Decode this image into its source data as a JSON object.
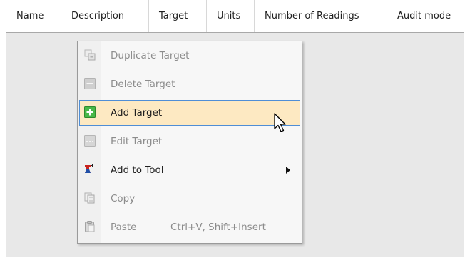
{
  "columns": [
    "Name",
    "Description",
    "Target",
    "Units",
    "Number of Readings",
    "Audit mode"
  ],
  "menu": {
    "items": [
      {
        "label": "Duplicate Target",
        "icon": "duplicate-icon",
        "enabled": false
      },
      {
        "label": "Delete Target",
        "icon": "minus-icon",
        "enabled": false
      },
      {
        "label": "Add Target",
        "icon": "plus-icon",
        "enabled": true,
        "highlighted": true
      },
      {
        "label": "Edit Target",
        "icon": "ellipsis-icon",
        "enabled": false
      },
      {
        "label": "Add to Tool",
        "icon": "tool-icon",
        "enabled": true,
        "submenu": true
      },
      {
        "label": "Copy",
        "icon": "copy-icon",
        "enabled": false
      },
      {
        "label": "Paste",
        "icon": "paste-icon",
        "enabled": false,
        "shortcut": "Ctrl+V, Shift+Insert"
      }
    ]
  },
  "colors": {
    "highlight_bg": "#fde9c2",
    "highlight_border": "#4f8ed6",
    "disabled_text": "#8c8c8c"
  }
}
